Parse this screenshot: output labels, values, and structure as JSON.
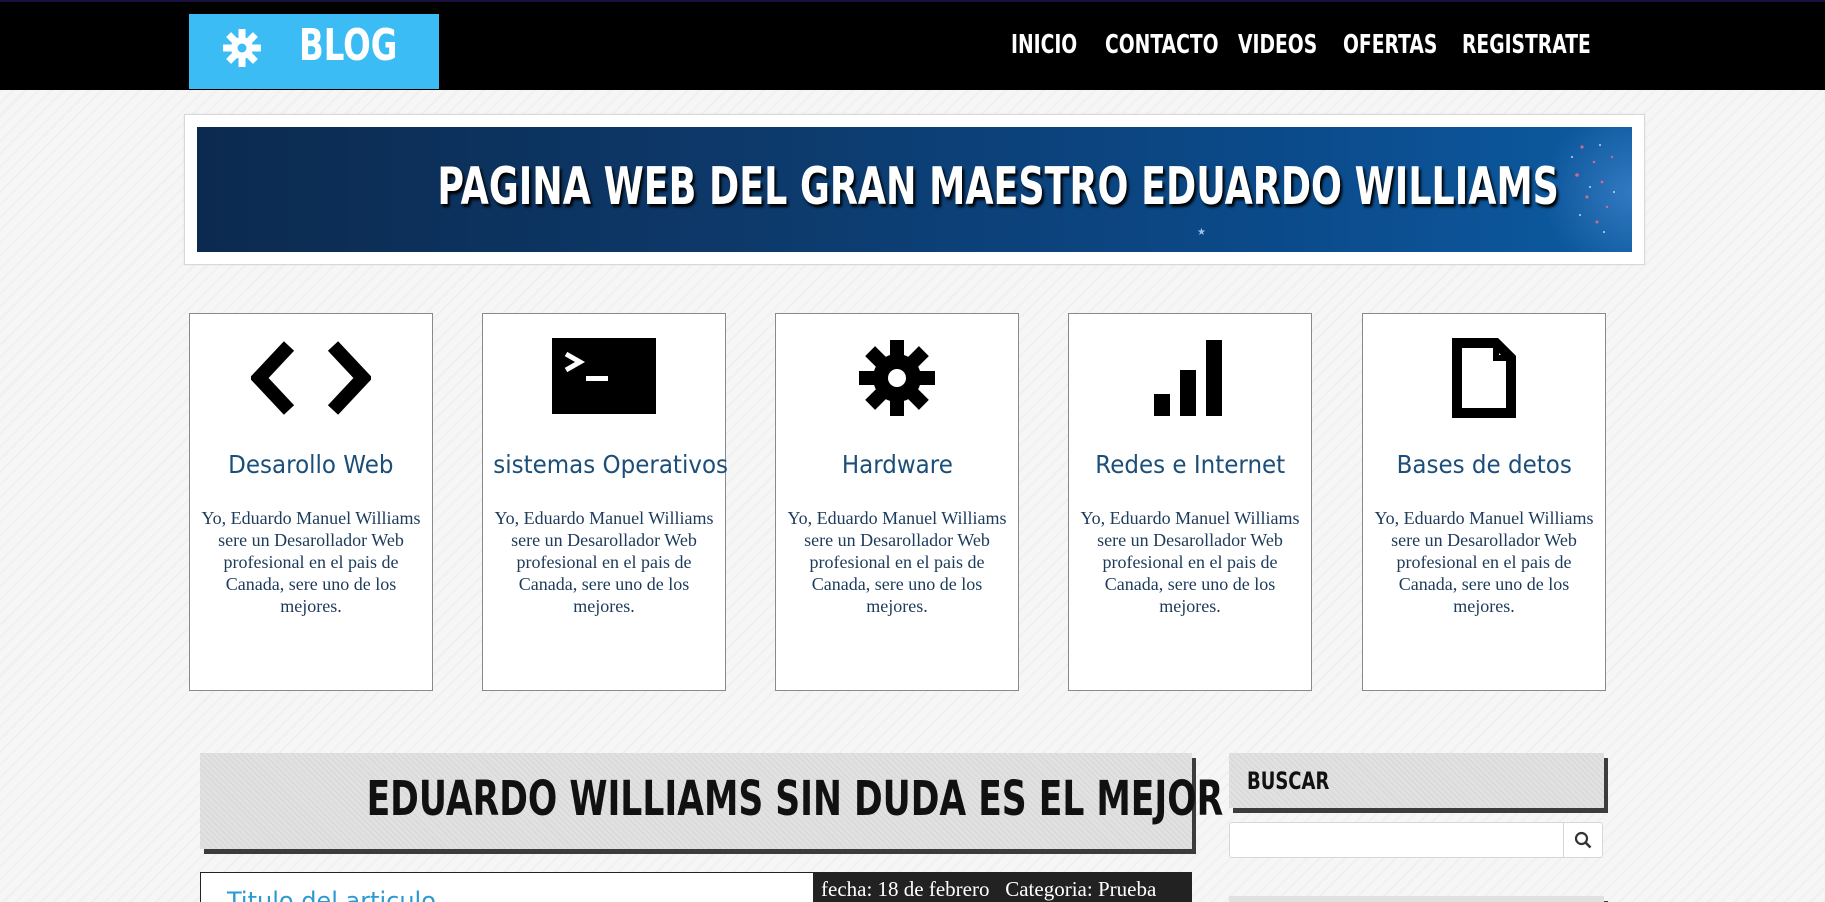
{
  "header": {
    "logo_text": "BLOG",
    "logo_icon": "gear-icon",
    "nav": [
      "INICIO",
      "CONTACTO",
      "VIDEOS",
      "OFERTAS",
      "REGISTRATE"
    ]
  },
  "banner": {
    "title": "PAGINA WEB DEL GRAN MAESTRO EDUARDO WILLIAMS"
  },
  "cards": [
    {
      "icon": "code-icon",
      "title": "Desarollo Web",
      "text": "Yo, Eduardo Manuel Williams sere un Desarollador Web profesional en el pais de Canada, sere uno de los mejores."
    },
    {
      "icon": "terminal-icon",
      "title": "sistemas Operativos",
      "text": "Yo, Eduardo Manuel Williams sere un Desarollador Web profesional en el pais de Canada, sere uno de los mejores."
    },
    {
      "icon": "gear-icon",
      "title": "Hardware",
      "text": "Yo, Eduardo Manuel Williams sere un Desarollador Web profesional en el pais de Canada, sere uno de los mejores."
    },
    {
      "icon": "signal-bars-icon",
      "title": "Redes e Internet",
      "text": "Yo, Eduardo Manuel Williams sere un Desarollador Web profesional en el pais de Canada, sere uno de los mejores."
    },
    {
      "icon": "file-icon",
      "title": "Bases de detos",
      "text": "Yo, Eduardo Manuel Williams sere un Desarollador Web profesional en el pais de Canada, sere uno de los mejores."
    }
  ],
  "main": {
    "section_title": "EDUARDO WILLIAMS SIN DUDA ES EL MEJOR",
    "article": {
      "title": "Titulo del articulo",
      "date": "fecha: 18 de febrero",
      "category": "Categoria: Prueba"
    }
  },
  "sidebar": {
    "search_title": "BUSCAR",
    "search_value": "",
    "search_icon": "search-icon"
  },
  "colors": {
    "accent": "#3bbcf5",
    "card_title": "#1b4f7a",
    "article_title": "#2a9ad0"
  }
}
